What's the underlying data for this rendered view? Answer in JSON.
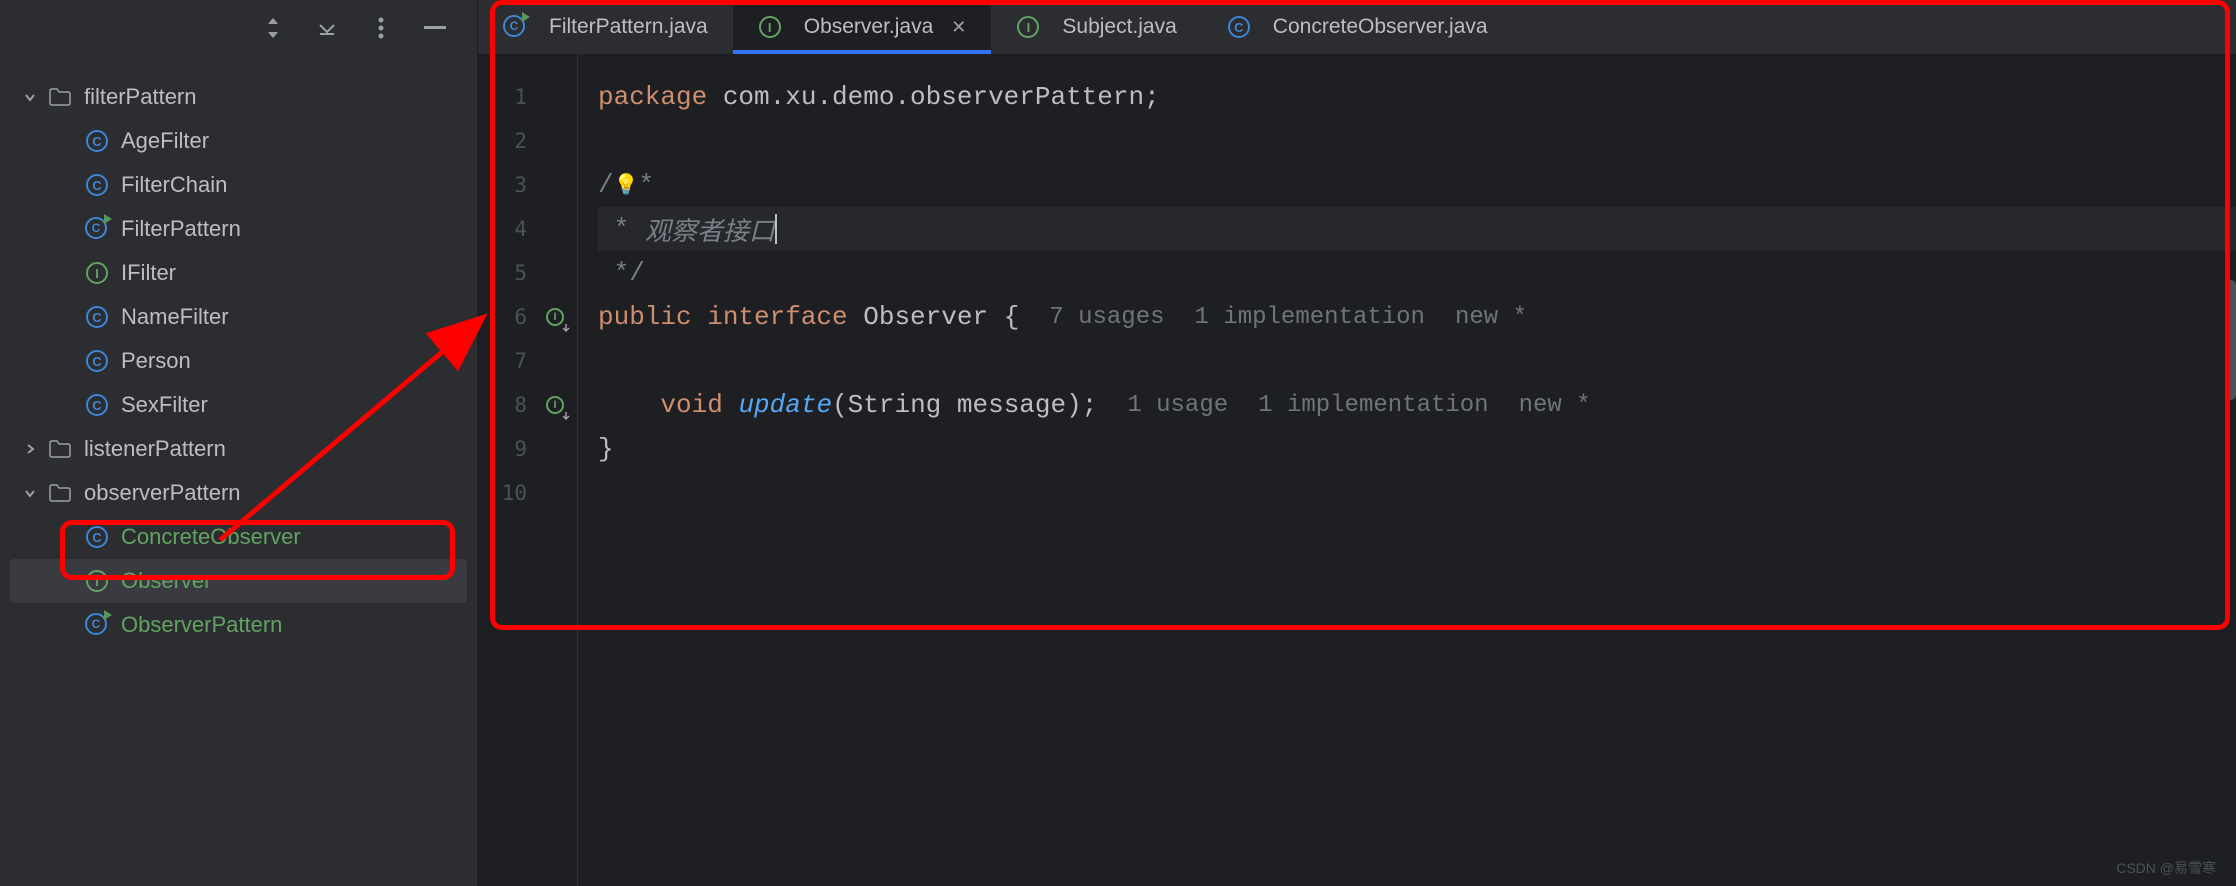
{
  "sidebar": {
    "tree": [
      {
        "type": "folder",
        "label": "filterPattern",
        "expanded": true,
        "indent": 1,
        "children": [
          {
            "type": "class",
            "label": "AgeFilter"
          },
          {
            "type": "class",
            "label": "FilterChain"
          },
          {
            "type": "runnable",
            "label": "FilterPattern"
          },
          {
            "type": "interface",
            "label": "IFilter"
          },
          {
            "type": "class",
            "label": "NameFilter"
          },
          {
            "type": "class",
            "label": "Person"
          },
          {
            "type": "class",
            "label": "SexFilter"
          }
        ]
      },
      {
        "type": "folder",
        "label": "listenerPattern",
        "expanded": false,
        "indent": 1
      },
      {
        "type": "folder",
        "label": "observerPattern",
        "expanded": true,
        "indent": 1,
        "children": [
          {
            "type": "class",
            "label": "ConcreteObserver",
            "added": true
          },
          {
            "type": "interface",
            "label": "Observer",
            "added": true,
            "selected": true
          },
          {
            "type": "runnable",
            "label": "ObserverPattern",
            "added": true
          }
        ]
      }
    ]
  },
  "tabs": [
    {
      "icon": "runnable",
      "label": "FilterPattern.java",
      "active": false
    },
    {
      "icon": "interface",
      "label": "Observer.java",
      "active": true,
      "closable": true
    },
    {
      "icon": "interface",
      "label": "Subject.java",
      "active": false
    },
    {
      "icon": "class",
      "label": "ConcreteObserver.java",
      "active": false
    }
  ],
  "code": {
    "lines": [
      {
        "n": 1,
        "segments": [
          {
            "t": "package ",
            "c": "kw"
          },
          {
            "t": "com.xu.demo.observerPattern;",
            "c": "str"
          }
        ]
      },
      {
        "n": 2,
        "segments": []
      },
      {
        "n": 3,
        "segments": [
          {
            "t": "/",
            "c": "comment"
          },
          {
            "t": "💡",
            "c": "bulb"
          },
          {
            "t": "*",
            "c": "comment"
          }
        ]
      },
      {
        "n": 4,
        "current": true,
        "segments": [
          {
            "t": " * ",
            "c": "comment"
          },
          {
            "t": "观察者接口",
            "c": "comment-italic"
          }
        ],
        "cursor": true
      },
      {
        "n": 5,
        "segments": [
          {
            "t": " */",
            "c": "comment"
          }
        ]
      },
      {
        "n": 6,
        "gutter": "impl",
        "segments": [
          {
            "t": "public interface ",
            "c": "kw"
          },
          {
            "t": "Observer ",
            "c": "cls"
          },
          {
            "t": "{",
            "c": "str"
          }
        ],
        "hints": [
          "7 usages",
          "1 implementation",
          "new *"
        ]
      },
      {
        "n": 7,
        "segments": []
      },
      {
        "n": 8,
        "gutter": "impl",
        "segments": [
          {
            "t": "    ",
            "c": "str"
          },
          {
            "t": "void ",
            "c": "kw"
          },
          {
            "t": "update",
            "c": "ifn"
          },
          {
            "t": "(String message);",
            "c": "str"
          }
        ],
        "hints": [
          "1 usage",
          "1 implementation",
          "new *"
        ]
      },
      {
        "n": 9,
        "segments": [
          {
            "t": "}",
            "c": "str"
          }
        ]
      },
      {
        "n": 10,
        "segments": []
      }
    ]
  },
  "watermark": "CSDN @易雪寒"
}
